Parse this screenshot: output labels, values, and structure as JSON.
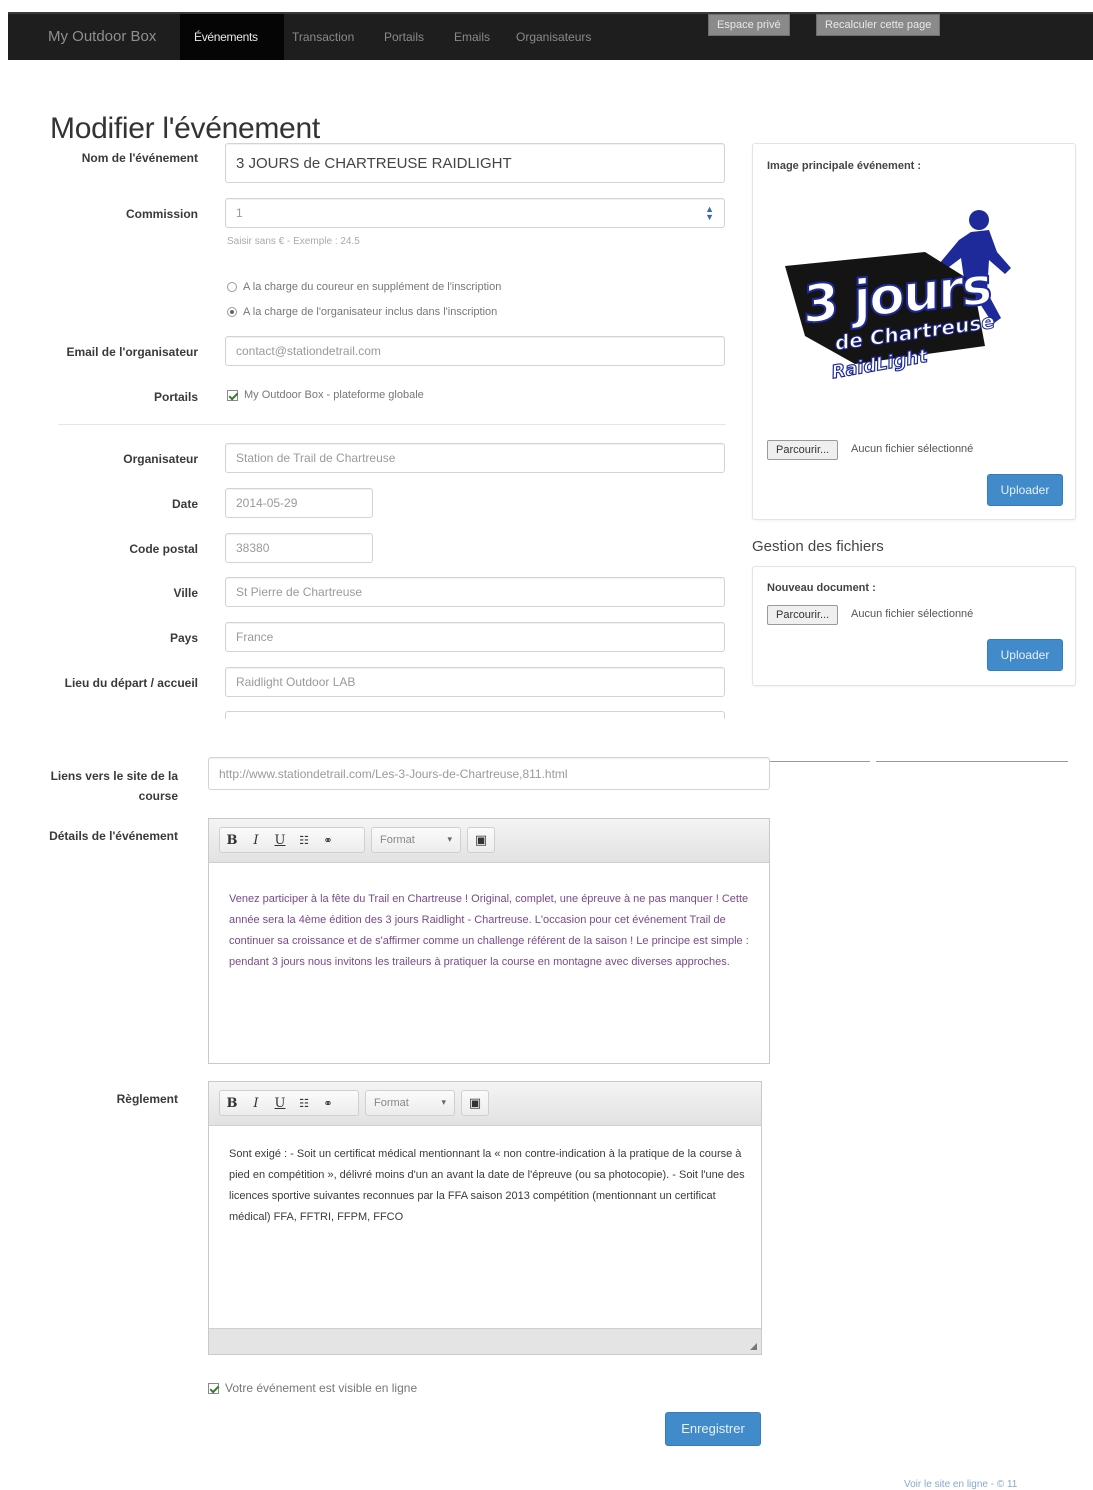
{
  "navbar": {
    "brand": "My Outdoor Box",
    "active_tab": "Événements",
    "tabs": [
      "Transaction",
      "Portails",
      "Emails",
      "Organisateurs"
    ],
    "espace_prive": "Espace privé",
    "recalculer": "Recalculer cette page"
  },
  "page": {
    "title": "Modifier l'événement"
  },
  "form": {
    "nom_label": "Nom de l'événement",
    "nom_value": "3 JOURS de CHARTREUSE RAIDLIGHT",
    "commission_label": "Commission",
    "commission_value": "1",
    "commission_help": "Saisir sans € - Exemple : 24.5",
    "radio_coureur": "A la charge du coureur en supplément de l'inscription",
    "radio_organisateur": "A la charge de l'organisateur inclus dans l'inscription",
    "email_label": "Email de l'organisateur",
    "email_value": "contact@stationdetrail.com",
    "portails_label": "Portails",
    "portails_option": "My Outdoor Box - plateforme globale",
    "organisateur_label": "Organisateur",
    "organisateur_value": "Station de Trail de Chartreuse",
    "date_label": "Date",
    "date_value": "2014-05-29",
    "cp_label": "Code postal",
    "cp_value": "38380",
    "ville_label": "Ville",
    "ville_value": "St Pierre de Chartreuse",
    "pays_label": "Pays",
    "pays_value": "France",
    "lieu_label": "Lieu du départ / accueil",
    "lieu_value": "Raidlight Outdoor LAB",
    "liens_label_1": "Liens vers le site de la",
    "liens_label_2": "course",
    "liens_value": "http://www.stationdetrail.com/Les-3-Jours-de-Chartreuse,811.html",
    "details_label": "Détails de l'événement",
    "details_text": "Venez participer à la fête du Trail en Chartreuse ! Original, complet, une épreuve à ne pas manquer ! Cette année sera la 4ème édition des 3 jours Raidlight - Chartreuse. L'occasion pour cet événement Trail de continuer sa croissance et de s'affirmer comme un challenge référent de la saison ! Le principe est simple : pendant 3 jours nous invitons les traileurs à pratiquer la course en montagne avec diverses approches.",
    "reglement_label": "Règlement",
    "reglement_text": "Sont exigé : - Soit un certificat médical mentionnant la « non contre-indication à la pratique de la course à pied en compétition », délivré moins d'un an avant la date de l'épreuve (ou sa photocopie). - Soit l'une des licences sportive suivantes reconnues par la FFA saison 2013 compétition (mentionnant un certificat médical) FFA, FFTRI, FFPM, FFCO",
    "toolbar_format": "Format",
    "visible_label": "Votre événement est visible en ligne",
    "save_button": "Enregistrer"
  },
  "image_panel": {
    "label": "Image principale événement :",
    "logo_top": "3 jours",
    "logo_mid": "de Chartreuse",
    "logo_brand": "RaidLight",
    "browse": "Parcourir...",
    "no_file": "Aucun fichier sélectionné",
    "upload": "Uploader"
  },
  "files_panel": {
    "title": "Gestion des fichiers",
    "label": "Nouveau document :",
    "browse": "Parcourir...",
    "no_file": "Aucun fichier sélectionné",
    "upload": "Uploader"
  },
  "footer": {
    "link": "Voir le site en ligne - © 11"
  },
  "colors": {
    "navbar": "#1e1e1e",
    "primary": "#428bca",
    "details_text": "#7a4a8a",
    "logo_blue": "#1f2a9a"
  }
}
